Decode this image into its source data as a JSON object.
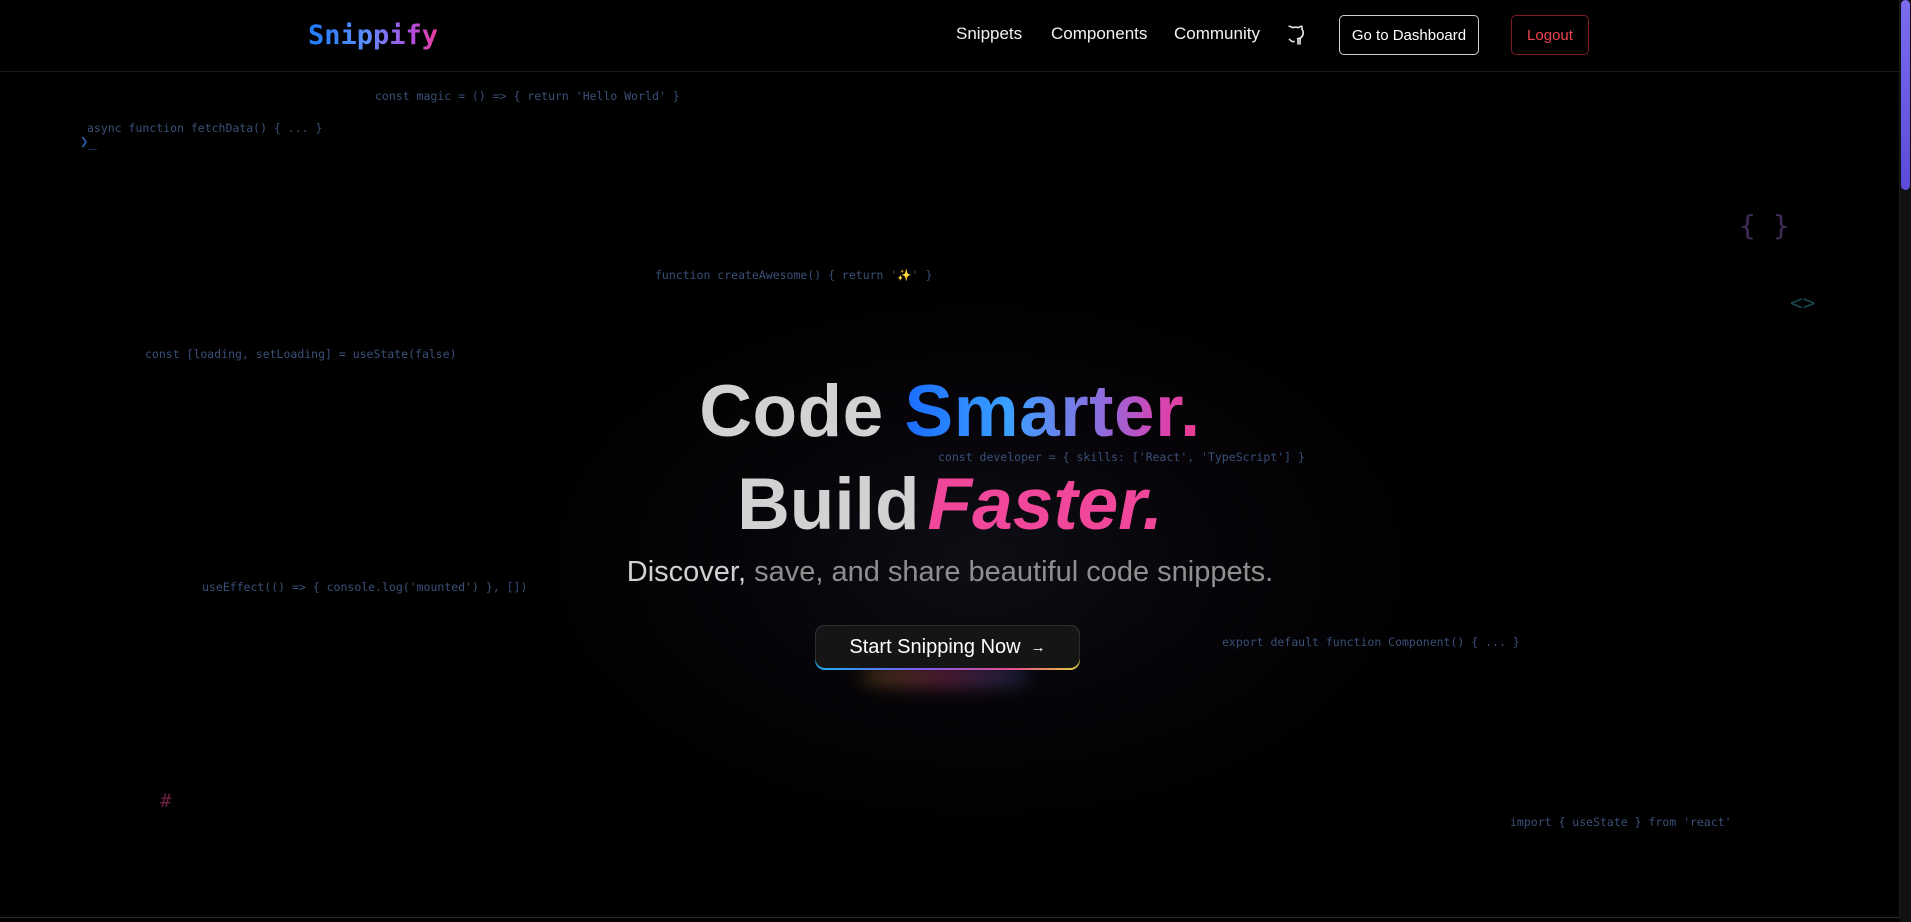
{
  "brand": {
    "logo": "Snippify"
  },
  "nav": {
    "links": [
      "Snippets",
      "Components",
      "Community"
    ],
    "github_icon": "github-icon",
    "dashboard_label": "Go to Dashboard",
    "logout_label": "Logout"
  },
  "background_code": [
    "const magic = () => { return 'Hello World' }",
    "async function fetchData() { ... }",
    "function createAwesome() { return '✨' }",
    "const [loading, setLoading] = useState(false)",
    "const developer = { skills: ['React', 'TypeScript'] }",
    "useEffect(() => { console.log('mounted') }, [])",
    "export default function Component() { ... }",
    "import { useState } from 'react'"
  ],
  "symbols": {
    "prompt": "❯_",
    "brace": "{ }",
    "angle": "<>",
    "hash": "#"
  },
  "hero": {
    "line1_plain": "Code",
    "line1_accent": "Smarter.",
    "line2_plain": "Build",
    "line2_accent": "Faster.",
    "subtitle_lead": "Discover,",
    "subtitle_rest": " save, and share beautiful code snippets.",
    "cta_label": "Start Snipping Now",
    "cta_arrow": "→"
  },
  "colors": {
    "accent_blue": "#1a6cff",
    "accent_pink": "#f0479a",
    "logout_red": "#f04352",
    "scroll_thumb": "#7c6cf0"
  }
}
